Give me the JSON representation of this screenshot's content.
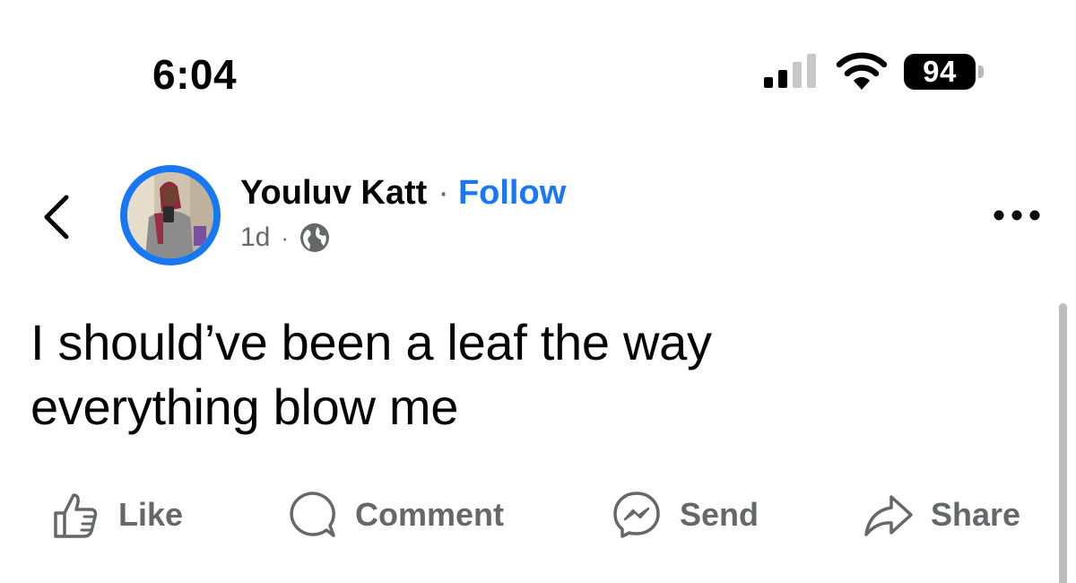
{
  "status_bar": {
    "time": "6:04",
    "battery_level": "94",
    "signal_bars_active": 2,
    "signal_bars_total": 4
  },
  "header": {
    "back_icon": "chevron-left-icon",
    "author_name": "Youluv Katt",
    "separator": "·",
    "follow_label": "Follow",
    "timestamp": "1d",
    "meta_separator": "·",
    "privacy_icon": "globe-icon",
    "more_icon": "more-horizontal-icon"
  },
  "post": {
    "line1": "I should’ve been a leaf the way",
    "line2": "everything blow me"
  },
  "actions": {
    "like_label": "Like",
    "comment_label": "Comment",
    "send_label": "Send",
    "share_label": "Share"
  },
  "colors": {
    "accent": "#1877f2",
    "secondary_text": "#65676b",
    "primary_text": "#050505"
  }
}
